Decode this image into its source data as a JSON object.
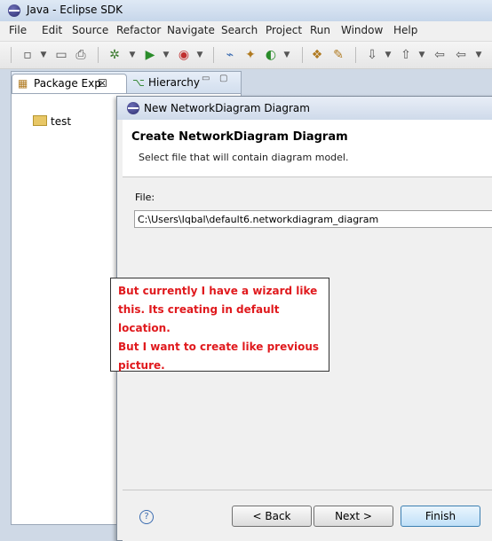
{
  "window": {
    "title": "Java - Eclipse SDK"
  },
  "menu": [
    "File",
    "Edit",
    "Source",
    "Refactor",
    "Navigate",
    "Search",
    "Project",
    "Run",
    "Window",
    "Help"
  ],
  "views": {
    "package_explorer_tab": "Package Exp",
    "hierarchy_tab": "Hierarchy",
    "tree_item": "test"
  },
  "dialog": {
    "title": "New NetworkDiagram Diagram",
    "header": "Create NetworkDiagram Diagram",
    "description": "Select file that will contain diagram model.",
    "file_label": "File:",
    "file_value": "C:\\Users\\Iqbal\\default6.networkdiagram_diagram",
    "note_lines": [
      "But currently I have a wizard like",
      "this. Its creating in default location.",
      "But I want to create like previous",
      "picture."
    ],
    "buttons": {
      "back": "< Back",
      "next": "Next >",
      "finish": "Finish"
    }
  }
}
